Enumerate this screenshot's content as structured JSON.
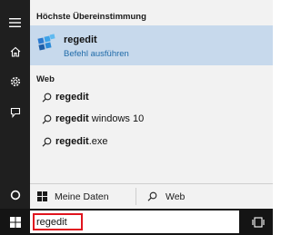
{
  "rail": {
    "items": [
      {
        "icon": "hamburger-menu-icon"
      },
      {
        "icon": "home-icon"
      },
      {
        "icon": "gear-icon"
      },
      {
        "icon": "feedback-icon"
      },
      {
        "icon": "cortana-circle-icon"
      }
    ]
  },
  "results": {
    "best_match_header": "Höchste Übereinstimmung",
    "best_match": {
      "title": "regedit",
      "subtitle": "Befehl ausführen",
      "icon": "registry-editor-icon"
    },
    "web_header": "Web",
    "web_items": [
      {
        "bold": "regedit",
        "rest": ""
      },
      {
        "bold": "regedit",
        "rest": " windows 10"
      },
      {
        "bold": "regedit",
        "rest": ".exe"
      }
    ]
  },
  "tabs": {
    "my_data": "Meine Daten",
    "web": "Web"
  },
  "taskbar": {
    "search_value": "regedit",
    "start_icon": "windows-logo-icon",
    "taskview_icon": "task-view-icon"
  },
  "colors": {
    "rail_bg": "#1f1f1f",
    "panel_bg": "#f2f2f2",
    "selection": "#c7d9ec",
    "subtitle_link": "#1f6aa8",
    "highlight_border": "#e0141e",
    "taskbar_bg": "#141414"
  }
}
